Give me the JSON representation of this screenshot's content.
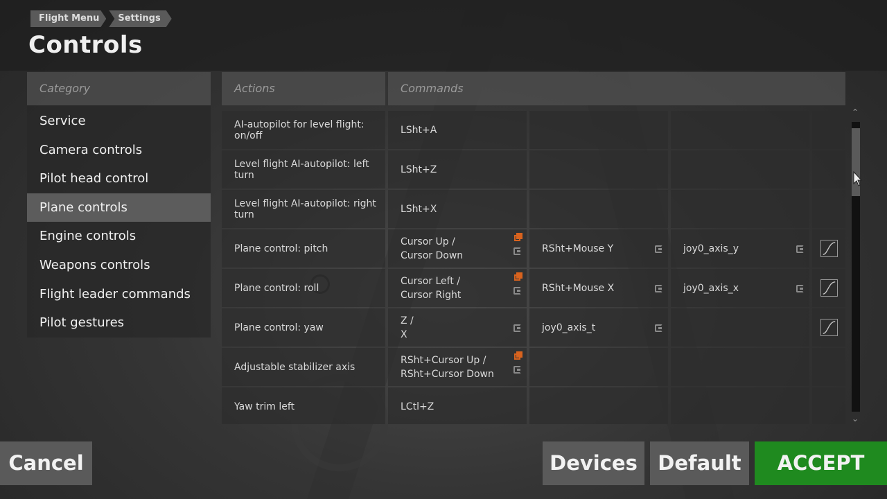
{
  "breadcrumb": [
    "Flight Menu",
    "Settings"
  ],
  "title": "Controls",
  "category_panel": {
    "header": "Category",
    "items": [
      "Service",
      "Camera controls",
      "Pilot head control",
      "Plane controls",
      "Engine controls",
      "Weapons controls",
      "Flight leader commands",
      "Pilot gestures"
    ],
    "selected": "Plane controls"
  },
  "table": {
    "headers": {
      "actions": "Actions",
      "commands": "Commands"
    },
    "rows": [
      {
        "action": "AI-autopilot for level flight: on/off",
        "cmd1": "LSht+A",
        "cmd2": "",
        "cmd3": ""
      },
      {
        "action": "Level flight AI-autopilot: left turn",
        "cmd1": "LSht+Z",
        "cmd2": "",
        "cmd3": ""
      },
      {
        "action": "Level flight AI-autopilot: right turn",
        "cmd1": "LSht+X",
        "cmd2": "",
        "cmd3": ""
      },
      {
        "action": "Plane control: pitch",
        "cmd1": "Cursor Up /\nCursor Down",
        "cmd2": "RSht+Mouse Y",
        "cmd3": "joy0_axis_y"
      },
      {
        "action": "Plane control: roll",
        "cmd1": "Cursor Left /\nCursor Right",
        "cmd2": "RSht+Mouse X",
        "cmd3": "joy0_axis_x"
      },
      {
        "action": "Plane control: yaw",
        "cmd1": "Z /\nX",
        "cmd2": "joy0_axis_t",
        "cmd3": ""
      },
      {
        "action": "Adjustable stabilizer axis",
        "cmd1": "RSht+Cursor Up /\nRSht+Cursor Down",
        "cmd2": "",
        "cmd3": ""
      },
      {
        "action": "Yaw trim left",
        "cmd1": "LCtl+Z",
        "cmd2": "",
        "cmd3": ""
      }
    ]
  },
  "icons": {
    "reset": "reset-binding-icon",
    "swap": "swap-direction-icon",
    "curve": "response-curve-icon",
    "scroll_up": "chevron-up-icon",
    "scroll_down": "chevron-down-icon"
  },
  "colors": {
    "accept": "#1f8a1f",
    "swap_icon": "#d9631e",
    "selected": "#5c5c5c"
  },
  "buttons": {
    "cancel": "Cancel",
    "devices": "Devices",
    "default": "Default",
    "accept": "ACCEPT"
  }
}
